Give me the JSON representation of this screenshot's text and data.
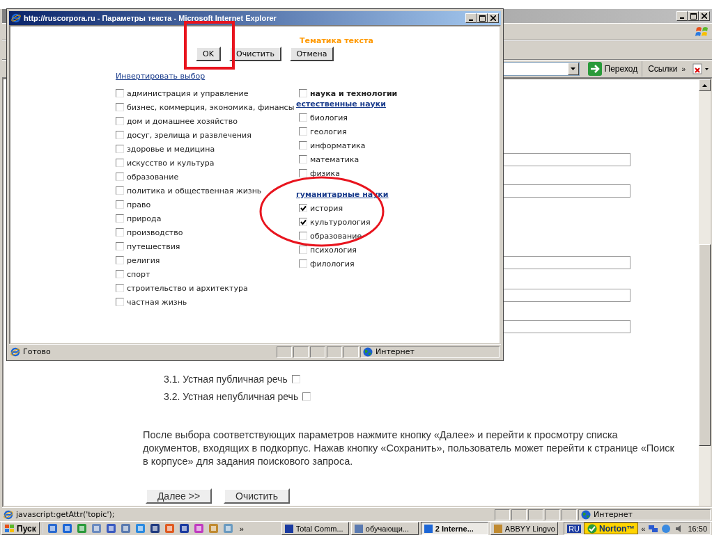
{
  "popup": {
    "title": "http://ruscorpora.ru - Параметры текста - Microsoft Internet Explorer",
    "heading": "Тематика текста",
    "buttons": [
      "OK",
      "Очистить",
      "Отмена"
    ],
    "invert_link": "Инвертировать выбор",
    "topics": [
      {
        "label": "администрация и управление",
        "checked": false
      },
      {
        "label": "бизнес, коммерция, экономика, финансы",
        "checked": false
      },
      {
        "label": "дом и домашнее хозяйство",
        "checked": false
      },
      {
        "label": "досуг, зрелища и развлечения",
        "checked": false
      },
      {
        "label": "здоровье и медицина",
        "checked": false
      },
      {
        "label": "искусство и культура",
        "checked": false
      },
      {
        "label": "образование",
        "checked": false
      },
      {
        "label": "политика и общественная жизнь",
        "checked": false
      },
      {
        "label": "право",
        "checked": false
      },
      {
        "label": "природа",
        "checked": false
      },
      {
        "label": "производство",
        "checked": false
      },
      {
        "label": "путешествия",
        "checked": false
      },
      {
        "label": "религия",
        "checked": false
      },
      {
        "label": "спорт",
        "checked": false
      },
      {
        "label": "строительство и архитектура",
        "checked": false
      },
      {
        "label": "частная жизнь",
        "checked": false
      }
    ],
    "science": {
      "label": "наука и технологии",
      "checked": false,
      "groups": [
        {
          "title": "естественные науки",
          "items": [
            {
              "label": "биология",
              "checked": false
            },
            {
              "label": "геология",
              "checked": false
            },
            {
              "label": "информатика",
              "checked": false
            },
            {
              "label": "математика",
              "checked": false
            },
            {
              "label": "физика",
              "checked": false
            }
          ]
        },
        {
          "title": "гуманитарные науки",
          "items": [
            {
              "label": "история",
              "checked": true
            },
            {
              "label": "культурология",
              "checked": true
            },
            {
              "label": "образование",
              "checked": false
            },
            {
              "label": "психология",
              "checked": false
            },
            {
              "label": "филология",
              "checked": false
            }
          ]
        }
      ]
    },
    "status": "Готово",
    "zone": "Интернет"
  },
  "browser": {
    "go": "Переход",
    "links": "Ссылки",
    "more": "»",
    "speech_items": [
      {
        "label": "3.1. Устная публичная речь",
        "checked": false
      },
      {
        "label": "3.2. Устная непубличная речь",
        "checked": false
      }
    ],
    "paragraph": "После выбора соответствующих параметров нажмите кнопку «Далее» и перейти к просмотру списка документов, входящих в подкорпус. Нажав кнопку «Сохранить», пользователь может перейти к странице «Поиск в корпусе» для задания поискового запроса.",
    "buttons": [
      "Далее >>",
      "Очистить"
    ],
    "status": "javascript:getAttr('topic');",
    "zone": "Интернет"
  },
  "taskbar": {
    "start": "Пуск",
    "more": "»",
    "tasks": [
      {
        "label": "Total Comm...",
        "selected": false
      },
      {
        "label": "обучающи...",
        "selected": false
      },
      {
        "label": "2 Interne...",
        "selected": true
      },
      {
        "label": "ABBYY Lingvo",
        "selected": false
      }
    ],
    "lang": "RU",
    "norton": "Norton™",
    "tray_more": "«",
    "clock": "16:50"
  }
}
